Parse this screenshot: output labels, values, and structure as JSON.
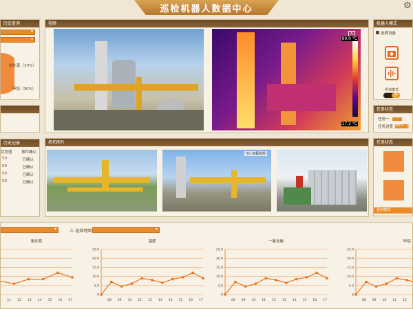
{
  "app": {
    "title": "巡检机器人数据中心"
  },
  "left": {
    "history_query": "历史查询",
    "legend_1": "氯化氢（30%）",
    "legend_2": "甲烷（30%）",
    "history_record": "历史记录",
    "status_header": "状态值",
    "event_header": "事件确认",
    "rows": [
      {
        "value": "50",
        "event": "已确认"
      },
      {
        "value": "50",
        "event": "已确认"
      },
      {
        "value": "50",
        "event": "已确认"
      },
      {
        "value": "50",
        "event": "已确认"
      }
    ]
  },
  "video": {
    "title": "视频",
    "thermal_max": "99.0 °C",
    "thermal_min": "17.2 °C",
    "thermal_marker": "A"
  },
  "capture": {
    "title": "抓拍图片",
    "overlay": "5G 远程巡检"
  },
  "robot": {
    "title": "机器人模式",
    "select_device": "选择设备",
    "manual_mode": "手动模式",
    "toggle_text": "开"
  },
  "task": {
    "title": "任务状态",
    "task1_label": "任务一",
    "progress_label": "任务进度",
    "progress_value": "90%",
    "progress": 0.9
  },
  "task2": {
    "title": "任务状态",
    "show_mode": "显示模式"
  },
  "bottom": {
    "select_map": "选择地图",
    "charts": [
      {
        "name": "氧化氮"
      },
      {
        "name": "温度"
      },
      {
        "name": "一氧化碳"
      },
      {
        "name": "甲烷"
      }
    ]
  },
  "chart_data": [
    {
      "type": "line",
      "title": "氧化氮",
      "x": [
        8,
        9,
        10,
        11,
        12,
        13,
        14,
        15,
        16,
        17
      ],
      "series": [
        {
          "values": [
            7.5,
            6.5,
            7.5,
            6,
            8.5,
            8.5,
            12,
            9.5
          ]
        }
      ],
      "ylim": [
        0,
        25
      ]
    },
    {
      "type": "line",
      "title": "温度",
      "x": [
        8,
        9,
        10,
        11,
        12,
        13,
        14,
        15,
        16,
        17
      ],
      "series": [
        {
          "values": [
            0,
            7,
            4.5,
            6,
            9,
            8,
            6.5,
            8.5,
            9.5,
            12,
            9
          ]
        }
      ],
      "ylim": [
        0,
        25
      ]
    },
    {
      "type": "line",
      "title": "一氧化碳",
      "x": [
        8,
        9,
        10,
        11,
        12,
        13,
        14,
        15,
        16,
        17
      ],
      "series": [
        {
          "values": [
            0,
            7,
            4.5,
            6,
            9,
            8,
            6.5,
            8.5,
            9.5,
            12,
            9
          ]
        }
      ],
      "ylim": [
        0,
        25
      ]
    },
    {
      "type": "line",
      "title": "甲烷",
      "x": [
        8,
        9,
        10,
        11,
        12,
        13,
        14,
        15,
        16,
        17
      ],
      "series": [
        {
          "values": [
            0,
            7,
            4.5,
            6,
            9,
            8,
            6.5,
            8.5,
            9.5,
            12,
            9
          ]
        }
      ],
      "ylim": [
        0,
        25
      ]
    }
  ],
  "y_ticks": [
    "25.0",
    "20.0",
    "15.0",
    "10.0",
    "5.0",
    "0"
  ],
  "x_ticks": [
    "08",
    "09",
    "10",
    "11",
    "12",
    "13",
    "14",
    "15",
    "16",
    "17"
  ],
  "colors": {
    "accent": "#e98a2b",
    "header": "#6a4a25",
    "line": "#e8721c"
  }
}
